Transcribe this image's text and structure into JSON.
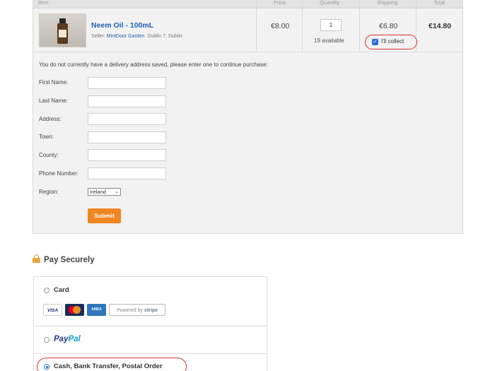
{
  "cart": {
    "headers": {
      "item": "Item",
      "price": "Price",
      "quantity": "Quantity",
      "shipping": "Shipping",
      "total": "Total"
    },
    "product": {
      "name": "Neem Oil - 100mL",
      "seller_prefix": "Seller:",
      "seller_name": "MintDoor Garden",
      "seller_location": "Dublin 7, Dublin",
      "price": "€8.00",
      "quantity": "1",
      "available": "19 available",
      "shipping": "€6.80",
      "collect_label": "I'll collect",
      "collect_checked": true,
      "total": "€14.80"
    }
  },
  "address_form": {
    "notice": "You do not currently have a delivery address saved, please enter one to continue purchase:",
    "fields": {
      "first_name": "First Name:",
      "last_name": "Last Name:",
      "address": "Address:",
      "town": "Town:",
      "county": "County:",
      "phone": "Phone Number:",
      "region": "Region:"
    },
    "region_value": "Ireland",
    "submit_label": "Submit"
  },
  "payment": {
    "title": "Pay Securely",
    "options": {
      "card": "Card",
      "paypal_a": "Pay",
      "paypal_b": "Pal",
      "cash": "Cash, Bank Transfer, Postal Order"
    },
    "selected": "cash",
    "logos": {
      "visa": "VISA",
      "amex": "AMERICAN EXPRESS",
      "stripe_prefix": "Powered by",
      "stripe_name": "stripe"
    }
  },
  "colors": {
    "link": "#1f5fb4",
    "submit": "#f0861f",
    "highlight": "#d9342b",
    "radio": "#2e6fd6"
  }
}
